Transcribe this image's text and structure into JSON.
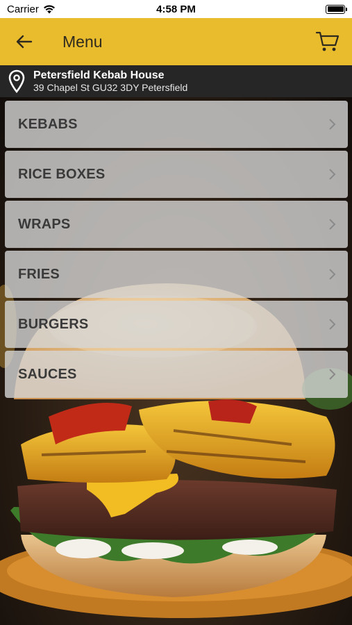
{
  "status_bar": {
    "carrier": "Carrier",
    "time": "4:58 PM"
  },
  "app_bar": {
    "title": "Menu",
    "back_icon": "arrow-left-icon",
    "cart_icon": "cart-icon",
    "background_color": "#e9bc2e"
  },
  "location": {
    "icon": "map-pin-icon",
    "name": "Petersfield Kebab House",
    "address": "39 Chapel St GU32 3DY Petersfield"
  },
  "menu": {
    "items": [
      {
        "label": "KEBABS"
      },
      {
        "label": "RICE BOXES"
      },
      {
        "label": "WRAPS"
      },
      {
        "label": "FRIES"
      },
      {
        "label": "BURGERS"
      },
      {
        "label": "SAUCES"
      }
    ],
    "chevron_icon": "chevron-right-icon"
  }
}
